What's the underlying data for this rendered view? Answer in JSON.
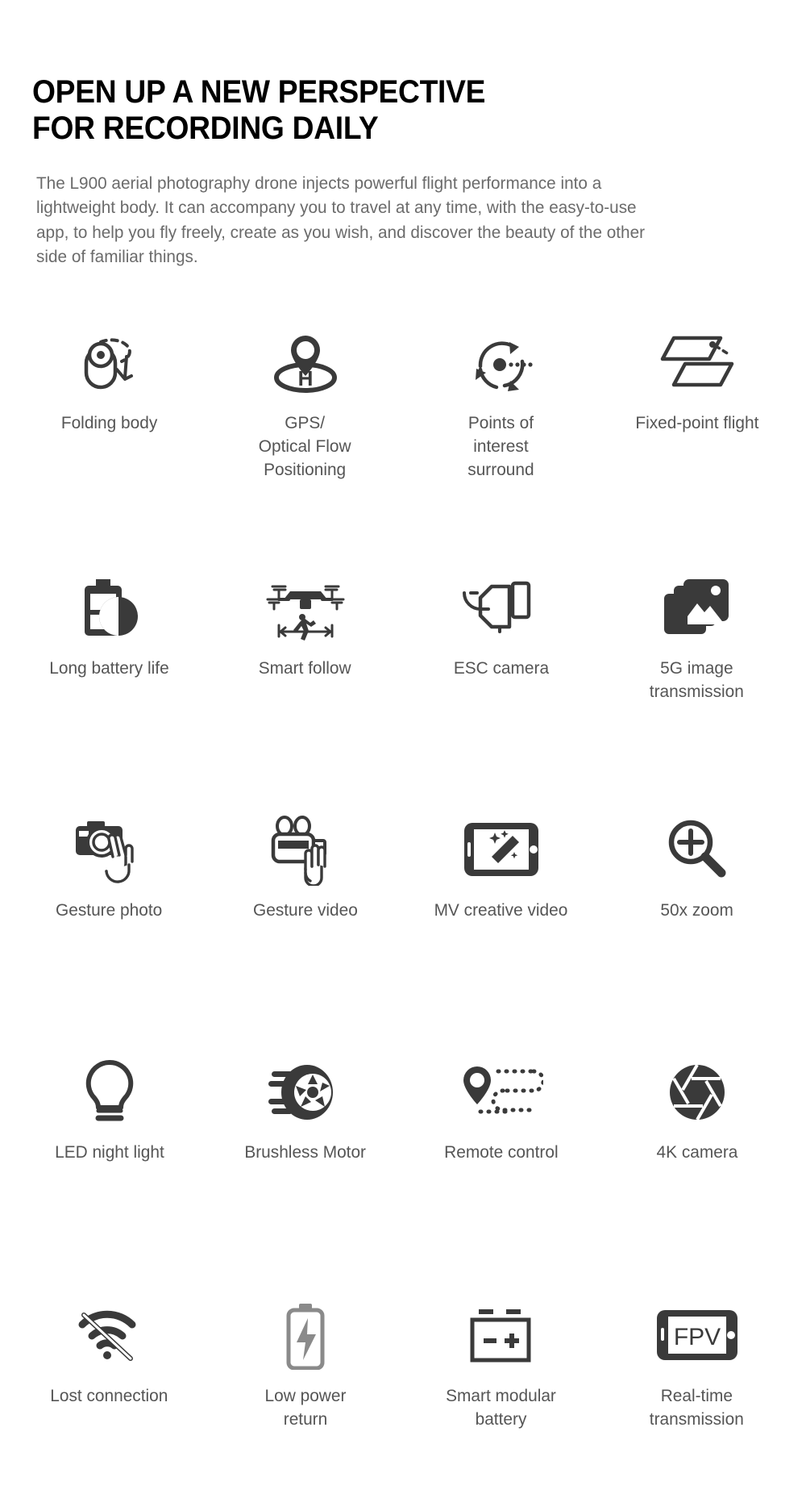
{
  "header": {
    "headline": "OPEN UP A NEW PERSPECTIVE\nFOR RECORDING DAILY",
    "intro": "The L900 aerial photography drone injects powerful flight performance into a lightweight body. It can accompany you to travel at any time, with the easy-to-use app, to help you fly freely, create as you wish, and discover the beauty of the other side of familiar things."
  },
  "colors": {
    "heading": "#000000",
    "body_text": "#6b6b6b",
    "label_text": "#555555",
    "icon": "#3a3a3a",
    "background": "#ffffff"
  },
  "features": [
    {
      "icon": "folding-body-icon",
      "label": "Folding body"
    },
    {
      "icon": "gps-optical-flow-icon",
      "label": "GPS/\nOptical Flow\nPositioning"
    },
    {
      "icon": "points-of-interest-icon",
      "label": "Points of\ninterest\nsurround"
    },
    {
      "icon": "fixed-point-flight-icon",
      "label": "Fixed-point flight"
    },
    {
      "icon": "long-battery-life-icon",
      "label": "Long battery life"
    },
    {
      "icon": "smart-follow-icon",
      "label": "Smart follow"
    },
    {
      "icon": "esc-camera-icon",
      "label": "ESC camera"
    },
    {
      "icon": "image-transmission-icon",
      "label": "5G image\ntransmission"
    },
    {
      "icon": "gesture-photo-icon",
      "label": "Gesture photo"
    },
    {
      "icon": "gesture-video-icon",
      "label": "Gesture video"
    },
    {
      "icon": "mv-creative-video-icon",
      "label": "MV creative video"
    },
    {
      "icon": "zoom-icon",
      "label": "50x zoom"
    },
    {
      "icon": "led-night-light-icon",
      "label": "LED night light"
    },
    {
      "icon": "brushless-motor-icon",
      "label": "Brushless Motor"
    },
    {
      "icon": "remote-control-icon",
      "label": "Remote control"
    },
    {
      "icon": "aperture-icon",
      "label": "4K camera"
    },
    {
      "icon": "lost-connection-icon",
      "label": "Lost connection"
    },
    {
      "icon": "low-power-return-icon",
      "label": "Low power\nreturn"
    },
    {
      "icon": "modular-battery-icon",
      "label": "Smart modular\nbattery"
    },
    {
      "icon": "fpv-screen-icon",
      "label": "Real-time\ntransmission"
    }
  ],
  "icon_text": {
    "fpv": "FPV",
    "helipad": "H"
  }
}
